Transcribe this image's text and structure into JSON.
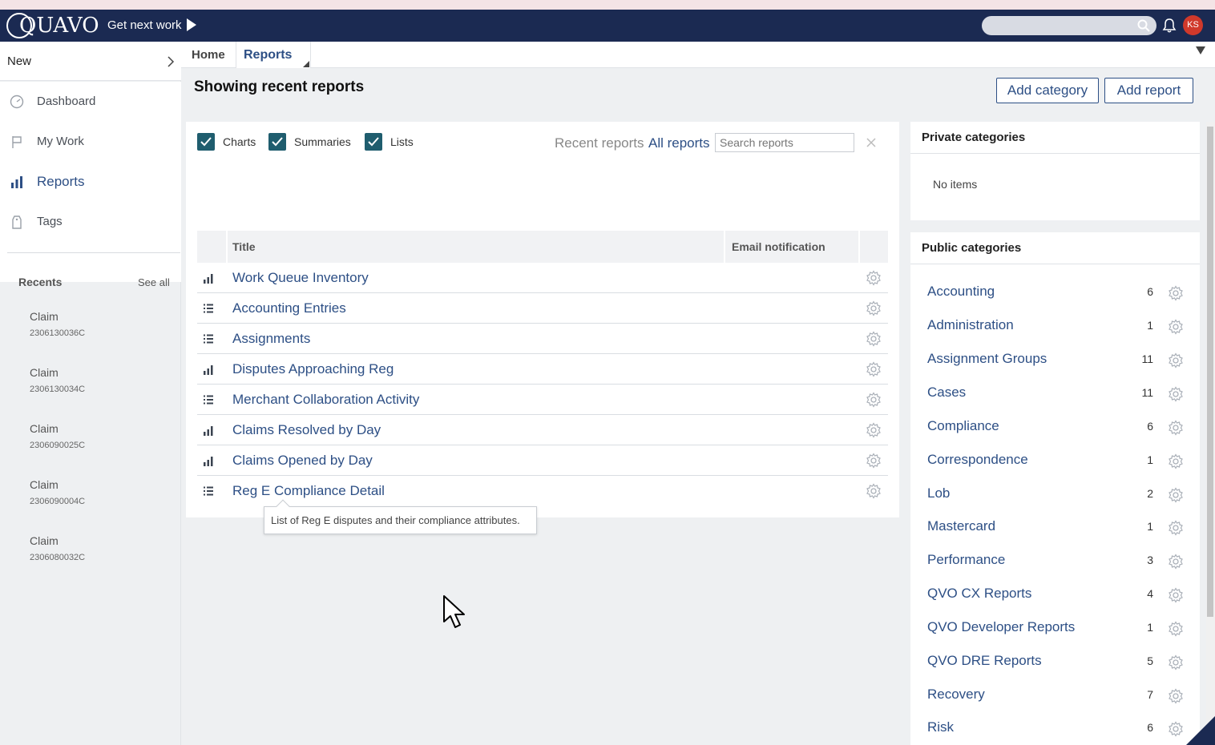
{
  "app": {
    "logo_text": "QUAVO",
    "get_next_work": "Get next work",
    "avatar_initials": "KS",
    "accent_color": "#2d4f85",
    "header_color": "#1b2a52"
  },
  "sidebar": {
    "new_label": "New",
    "items": [
      {
        "label": "Dashboard",
        "icon": "dashboard-icon"
      },
      {
        "label": "My Work",
        "icon": "flag-icon"
      },
      {
        "label": "Reports",
        "icon": "bar-chart-icon"
      },
      {
        "label": "Tags",
        "icon": "tag-icon"
      }
    ],
    "recents_title": "Recents",
    "see_all": "See all",
    "recents": [
      {
        "title": "Claim",
        "id": "2306130036C"
      },
      {
        "title": "Claim",
        "id": "2306130034C"
      },
      {
        "title": "Claim",
        "id": "2306090025C"
      },
      {
        "title": "Claim",
        "id": "2306090004C"
      },
      {
        "title": "Claim",
        "id": "2306080032C"
      }
    ]
  },
  "tabs": [
    {
      "label": "Home"
    },
    {
      "label": "Reports"
    }
  ],
  "page": {
    "title": "Showing recent reports",
    "add_category": "Add category",
    "add_report": "Add report"
  },
  "filters": {
    "charts": "Charts",
    "summaries": "Summaries",
    "lists": "Lists",
    "recent_reports": "Recent reports",
    "all_reports": "All reports",
    "search_placeholder": "Search reports"
  },
  "table": {
    "col_title": "Title",
    "col_email": "Email notification",
    "rows": [
      {
        "type": "chart",
        "title": "Work Queue Inventory"
      },
      {
        "type": "list",
        "title": "Accounting Entries"
      },
      {
        "type": "list",
        "title": "Assignments"
      },
      {
        "type": "chart",
        "title": "Disputes Approaching Reg"
      },
      {
        "type": "list",
        "title": "Merchant Collaboration Activity"
      },
      {
        "type": "chart",
        "title": "Claims Resolved by Day"
      },
      {
        "type": "chart",
        "title": "Claims Opened by Day"
      },
      {
        "type": "list",
        "title": "Reg E Compliance Detail"
      }
    ]
  },
  "tooltip": "List of Reg E disputes and their compliance attributes.",
  "private_categories": {
    "title": "Private categories",
    "empty": "No items"
  },
  "public_categories": {
    "title": "Public categories",
    "items": [
      {
        "name": "Accounting",
        "count": "6"
      },
      {
        "name": "Administration",
        "count": "1"
      },
      {
        "name": "Assignment Groups",
        "count": "11"
      },
      {
        "name": "Cases",
        "count": "11"
      },
      {
        "name": "Compliance",
        "count": "6"
      },
      {
        "name": "Correspondence",
        "count": "1"
      },
      {
        "name": "Lob",
        "count": "2"
      },
      {
        "name": "Mastercard",
        "count": "1"
      },
      {
        "name": "Performance",
        "count": "3"
      },
      {
        "name": "QVO CX Reports",
        "count": "4"
      },
      {
        "name": "QVO Developer Reports",
        "count": "1"
      },
      {
        "name": "QVO DRE Reports",
        "count": "5"
      },
      {
        "name": "Recovery",
        "count": "7"
      },
      {
        "name": "Risk",
        "count": "6"
      }
    ]
  }
}
